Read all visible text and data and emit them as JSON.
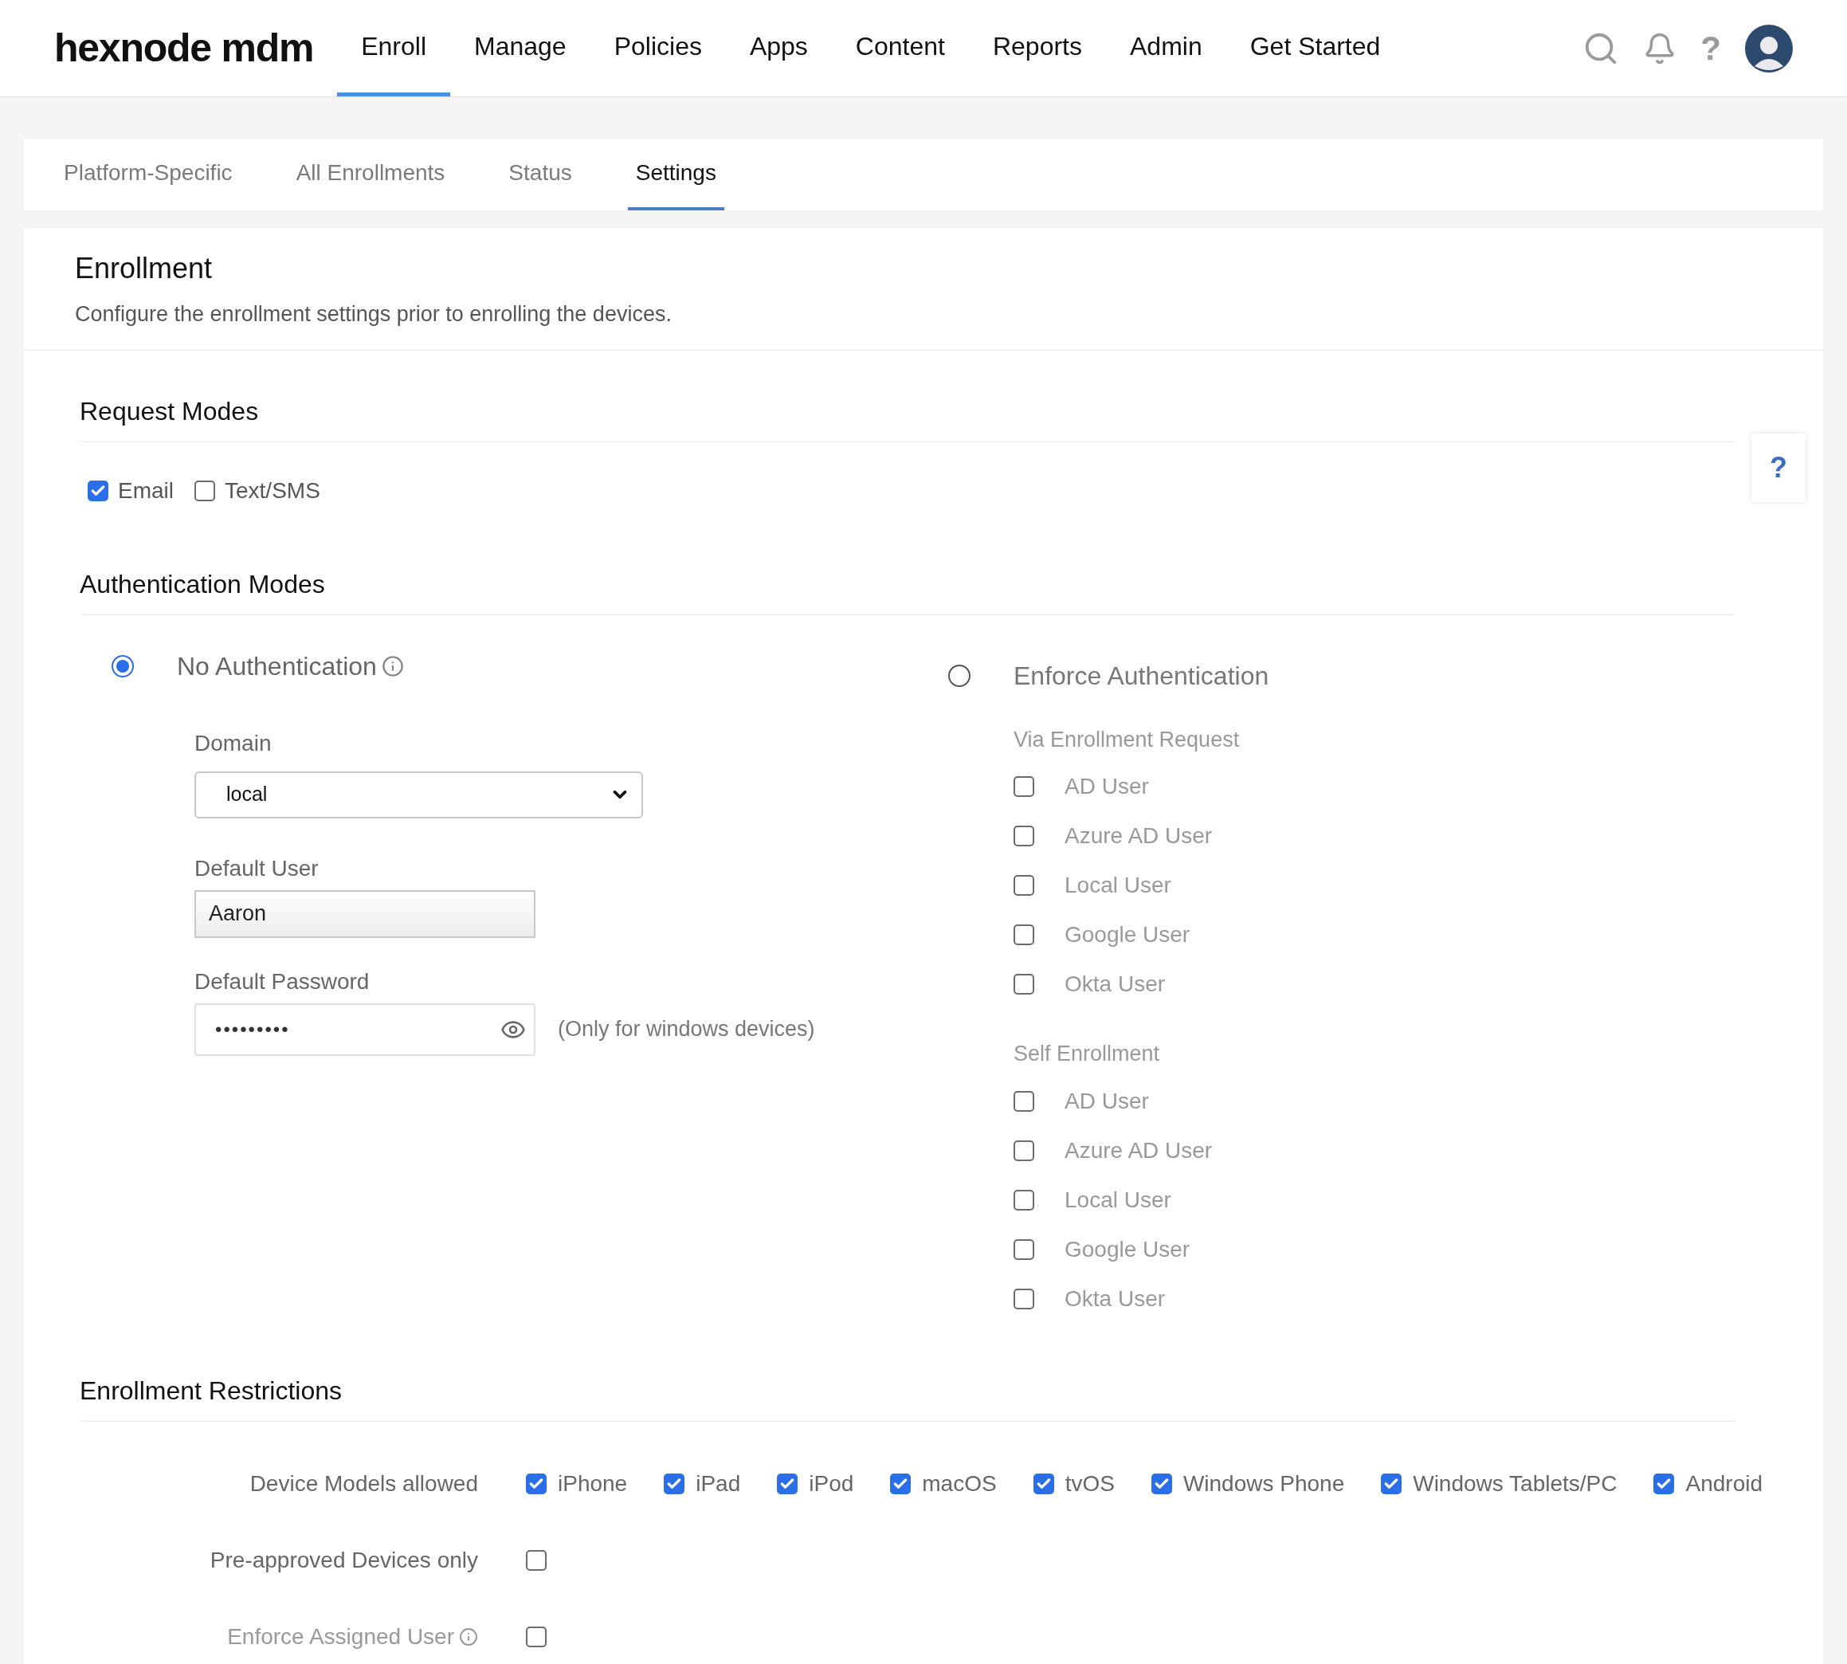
{
  "brand": {
    "logo": "hexnode mdm"
  },
  "nav": [
    {
      "label": "Enroll",
      "selected": true
    },
    {
      "label": "Manage",
      "selected": false
    },
    {
      "label": "Policies",
      "selected": false
    },
    {
      "label": "Apps",
      "selected": false
    },
    {
      "label": "Content",
      "selected": false
    },
    {
      "label": "Reports",
      "selected": false
    },
    {
      "label": "Admin",
      "selected": false
    },
    {
      "label": "Get Started",
      "selected": false
    }
  ],
  "header_help": "?",
  "tabs": [
    {
      "label": "Platform-Specific",
      "selected": false
    },
    {
      "label": "All Enrollments",
      "selected": false
    },
    {
      "label": "Status",
      "selected": false
    },
    {
      "label": "Settings",
      "selected": true
    }
  ],
  "page": {
    "title": "Enrollment",
    "description": "Configure the enrollment settings prior to enrolling the devices."
  },
  "help_button": "?",
  "request_modes": {
    "title": "Request Modes",
    "options": [
      {
        "label": "Email",
        "checked": true
      },
      {
        "label": "Text/SMS",
        "checked": false
      }
    ]
  },
  "authentication_modes": {
    "title": "Authentication Modes",
    "no_auth": {
      "label": "No Authentication",
      "selected": true,
      "domain": {
        "label": "Domain",
        "value": "local"
      },
      "default_user": {
        "label": "Default User",
        "value": "Aaron"
      },
      "default_password": {
        "label": "Default Password",
        "value": "•••••••••",
        "note": "(Only for windows devices)"
      }
    },
    "enforce_auth": {
      "label": "Enforce Authentication",
      "selected": false,
      "groups": [
        {
          "title": "Via Enrollment Request",
          "options": [
            {
              "label": "AD User",
              "checked": false
            },
            {
              "label": "Azure AD User",
              "checked": false
            },
            {
              "label": "Local User",
              "checked": false
            },
            {
              "label": "Google User",
              "checked": false
            },
            {
              "label": "Okta User",
              "checked": false
            }
          ]
        },
        {
          "title": "Self Enrollment",
          "options": [
            {
              "label": "AD User",
              "checked": false
            },
            {
              "label": "Azure AD User",
              "checked": false
            },
            {
              "label": "Local User",
              "checked": false
            },
            {
              "label": "Google User",
              "checked": false
            },
            {
              "label": "Okta User",
              "checked": false
            }
          ]
        }
      ]
    }
  },
  "restrictions": {
    "title": "Enrollment Restrictions",
    "rows": [
      {
        "label": "Device Models allowed",
        "kind": "multi",
        "info": false,
        "disabled": false,
        "options": [
          {
            "label": "iPhone",
            "checked": true
          },
          {
            "label": "iPad",
            "checked": true
          },
          {
            "label": "iPod",
            "checked": true
          },
          {
            "label": "macOS",
            "checked": true
          },
          {
            "label": "tvOS",
            "checked": true
          },
          {
            "label": "Windows Phone",
            "checked": true
          },
          {
            "label": "Windows Tablets/PC",
            "checked": true
          },
          {
            "label": "Android",
            "checked": true
          }
        ]
      },
      {
        "label": "Pre-approved Devices only",
        "kind": "single",
        "info": false,
        "disabled": false,
        "checked": false
      },
      {
        "label": "Enforce Assigned User",
        "kind": "single",
        "info": true,
        "disabled": true,
        "checked": false
      }
    ]
  }
}
